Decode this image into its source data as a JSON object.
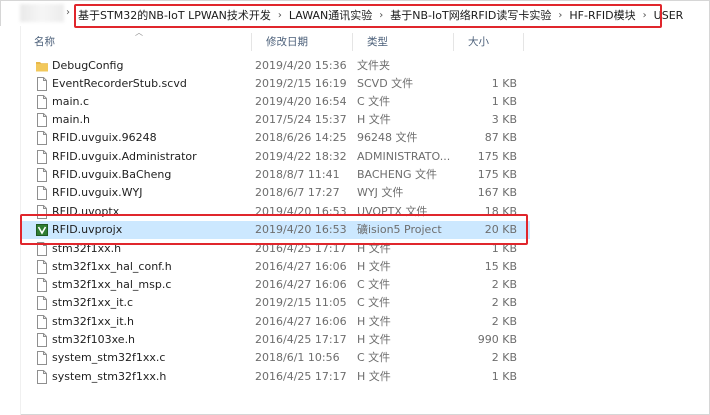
{
  "address_bar": {
    "crumbs": [
      "基于STM32的NB-IoT LPWAN技术开发",
      "LAWAN通讯实验",
      "基于NB-IoT网络RFID读写卡实验",
      "HF-RFID模块",
      "USER"
    ]
  },
  "columns": {
    "name": "名称",
    "date": "修改日期",
    "type": "类型",
    "size": "大小"
  },
  "files": [
    {
      "name": "DebugConfig",
      "date": "2019/4/20 15:36",
      "type": "文件夹",
      "size": "",
      "icon": "folder-icon"
    },
    {
      "name": "EventRecorderStub.scvd",
      "date": "2019/2/15 16:19",
      "type": "SCVD 文件",
      "size": "1 KB",
      "icon": "file-icon"
    },
    {
      "name": "main.c",
      "date": "2019/4/20 16:54",
      "type": "C 文件",
      "size": "1 KB",
      "icon": "file-icon"
    },
    {
      "name": "main.h",
      "date": "2017/5/24 15:37",
      "type": "H 文件",
      "size": "3 KB",
      "icon": "file-icon"
    },
    {
      "name": "RFID.uvguix.96248",
      "date": "2018/6/26 14:25",
      "type": "96248 文件",
      "size": "87 KB",
      "icon": "file-icon"
    },
    {
      "name": "RFID.uvguix.Administrator",
      "date": "2019/4/22 18:32",
      "type": "ADMINISTRATO...",
      "size": "175 KB",
      "icon": "file-icon"
    },
    {
      "name": "RFID.uvguix.BaCheng",
      "date": "2018/8/7 11:41",
      "type": "BACHENG 文件",
      "size": "175 KB",
      "icon": "file-icon"
    },
    {
      "name": "RFID.uvguix.WYJ",
      "date": "2018/6/7 17:27",
      "type": "WYJ 文件",
      "size": "167 KB",
      "icon": "file-icon"
    },
    {
      "name": "RFID.uvoptx",
      "date": "2019/4/20 16:53",
      "type": "UVOPTX 文件",
      "size": "18 KB",
      "icon": "file-icon"
    },
    {
      "name": "RFID.uvprojx",
      "date": "2019/4/20 16:53",
      "type": "礦ision5 Project",
      "size": "20 KB",
      "icon": "keil-project-icon",
      "selected": true
    },
    {
      "name": "stm32f1xx.h",
      "date": "2016/4/25 17:17",
      "type": "H 文件",
      "size": "1 KB",
      "icon": "file-icon"
    },
    {
      "name": "stm32f1xx_hal_conf.h",
      "date": "2016/4/27 16:06",
      "type": "H 文件",
      "size": "15 KB",
      "icon": "file-icon"
    },
    {
      "name": "stm32f1xx_hal_msp.c",
      "date": "2016/4/27 16:06",
      "type": "C 文件",
      "size": "2 KB",
      "icon": "file-icon"
    },
    {
      "name": "stm32f1xx_it.c",
      "date": "2019/2/15 11:05",
      "type": "C 文件",
      "size": "2 KB",
      "icon": "file-icon"
    },
    {
      "name": "stm32f1xx_it.h",
      "date": "2016/4/27 16:06",
      "type": "H 文件",
      "size": "2 KB",
      "icon": "file-icon"
    },
    {
      "name": "stm32f103xe.h",
      "date": "2016/4/25 17:17",
      "type": "H 文件",
      "size": "990 KB",
      "icon": "file-icon"
    },
    {
      "name": "system_stm32f1xx.c",
      "date": "2018/6/1 10:56",
      "type": "C 文件",
      "size": "2 KB",
      "icon": "file-icon"
    },
    {
      "name": "system_stm32f1xx.h",
      "date": "2016/4/25 17:17",
      "type": "H 文件",
      "size": "1 KB",
      "icon": "file-icon"
    }
  ],
  "colors": {
    "highlight": "#e0262c",
    "selection": "#cce8ff",
    "folder": "#e8b84a",
    "header_text": "#4c607a"
  }
}
